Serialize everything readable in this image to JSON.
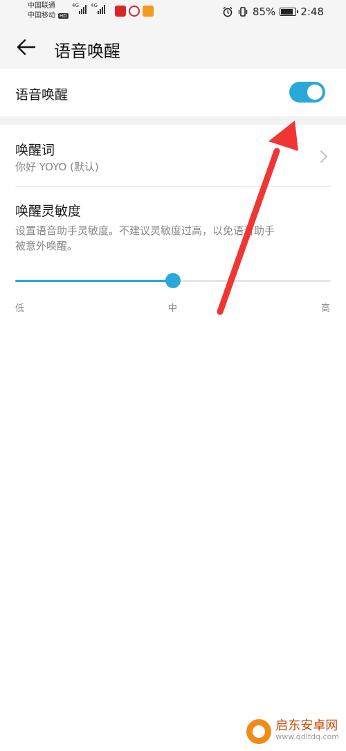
{
  "status_bar": {
    "carrier_1": "中国联通",
    "carrier_2": "中国移动",
    "hd_badge": "HD",
    "network_1": "4G",
    "network_2": "4G",
    "battery_percent": "85%",
    "battery_level": 0.85,
    "time": "2:48"
  },
  "header": {
    "title": "语音唤醒"
  },
  "wake_toggle": {
    "label": "语音唤醒",
    "enabled": true
  },
  "wake_word": {
    "label": "唤醒词",
    "value": "你好 YOYO (默认)"
  },
  "sensitivity": {
    "label": "唤醒灵敏度",
    "description_line_1": "设置语音助手灵敏度。不建议灵敏度过高，以免语音助手",
    "description_line_2": "被意外唤醒。",
    "level": 0.5,
    "ticks": [
      "低",
      "中",
      "高"
    ]
  },
  "watermark": {
    "name": "启东安卓网",
    "url": "www.qdltdq.com"
  },
  "colors": {
    "accent": "#2aa9d8",
    "annotation": "#f03535"
  }
}
